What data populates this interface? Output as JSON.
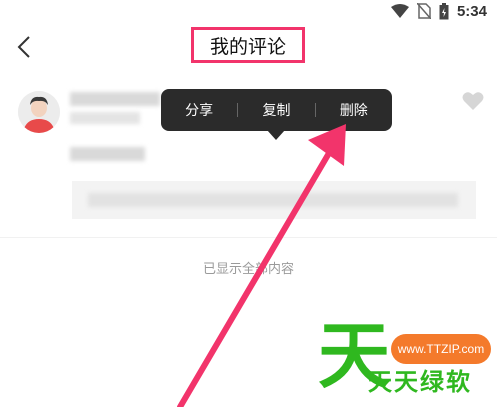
{
  "status_bar": {
    "time": "5:34",
    "icons": [
      "wifi-icon",
      "no-sim-icon",
      "battery-icon"
    ]
  },
  "header": {
    "back_icon": "chevron-left-icon",
    "title": "我的评论"
  },
  "context_menu": {
    "items": [
      {
        "label": "分享"
      },
      {
        "label": "复制"
      },
      {
        "label": "删除"
      }
    ]
  },
  "comment": {
    "like_icon": "heart-icon"
  },
  "footer": {
    "shown_all": "已显示全部内容"
  },
  "watermark": {
    "big_char": "天",
    "url": "www.TTZIP.com",
    "brand": "天天绿软"
  },
  "colors": {
    "highlight": "#f2346b",
    "menu_bg": "#2b2b2b",
    "watermark_green": "#2fb81f",
    "watermark_orange": "#f47a2b"
  }
}
